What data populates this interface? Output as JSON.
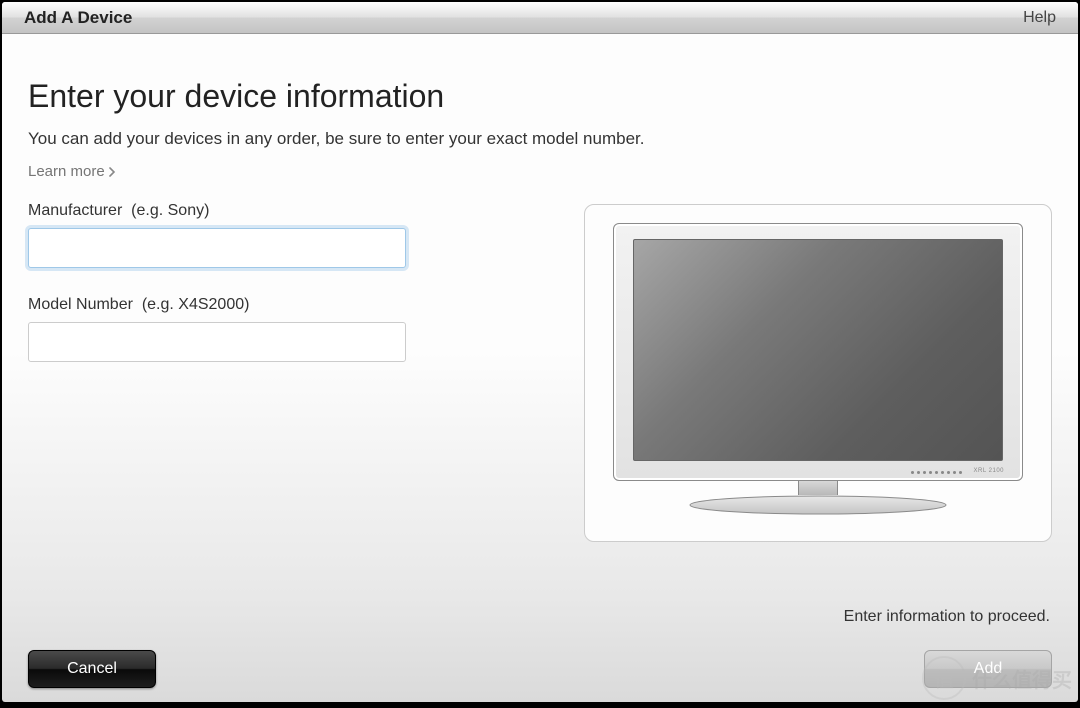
{
  "titlebar": {
    "title": "Add A Device",
    "help": "Help"
  },
  "main": {
    "heading": "Enter your device information",
    "subtext": "You can add your devices in any order, be sure to enter your exact model number.",
    "learn_more": "Learn more"
  },
  "fields": {
    "manufacturer": {
      "label": "Manufacturer",
      "hint": "(e.g. Sony)",
      "value": ""
    },
    "model": {
      "label": "Model Number",
      "hint": "(e.g. X4S2000)",
      "value": ""
    }
  },
  "status": {
    "proceed_hint": "Enter information to proceed."
  },
  "footer": {
    "cancel": "Cancel",
    "add": "Add"
  },
  "watermark": {
    "badge": "值",
    "text": "什么值得买"
  },
  "device_preview": {
    "type": "tv",
    "model_label": "XRL 2100"
  }
}
